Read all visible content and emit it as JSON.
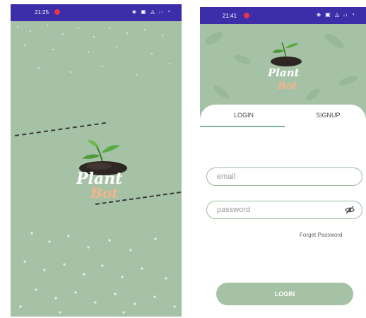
{
  "splash": {
    "status_time": "21:25",
    "status_icons": "◈ ▣ ◬ ᵢₗ ◔",
    "logo_text_line1": "Plant",
    "logo_text_line2": "Bot"
  },
  "login": {
    "status_time": "21:41",
    "status_icons": "◈ ▣ ◬ ᵢₗ ◔",
    "logo_text_line1": "Plant",
    "logo_text_line2": "Bot",
    "tabs": [
      {
        "label": "LOGIN",
        "active": true
      },
      {
        "label": "SIGNUP",
        "active": false
      }
    ],
    "email_placeholder": "email",
    "password_placeholder": "password",
    "forgot_password": "Forget Password",
    "login_button": "LOGIN"
  },
  "colors": {
    "sage": "#a6c2a6",
    "status_bar": "#3c2da8",
    "tab_accent": "#7fb1a4",
    "logo_peach": "#f2b48c"
  },
  "icons": [
    "eye-off-icon",
    "notification-dot-icon"
  ]
}
